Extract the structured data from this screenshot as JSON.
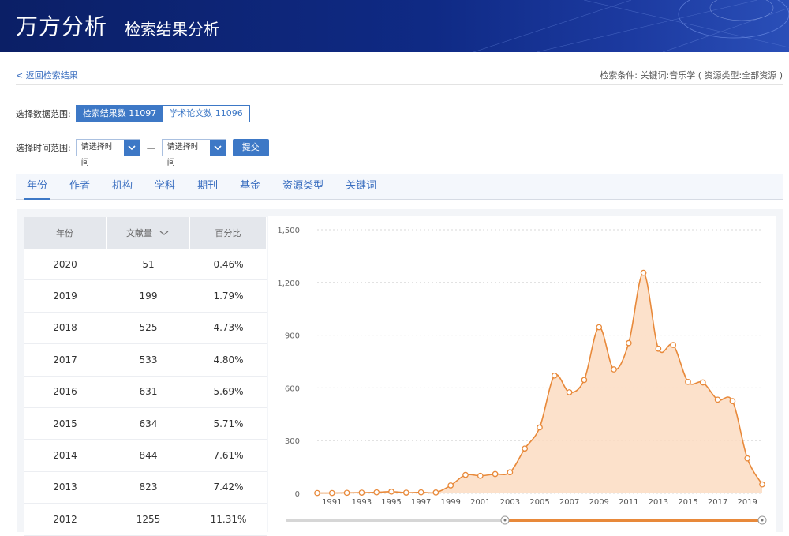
{
  "header": {
    "brand": "万方分析",
    "subtitle": "检索结果分析"
  },
  "topbar": {
    "back": "< 返回检索结果",
    "conditions": "检索条件:  关键词:音乐学  ( 资源类型:全部资源 )"
  },
  "data_range": {
    "label": "选择数据范围:",
    "options": [
      {
        "label": "检索结果数 11097",
        "active": true
      },
      {
        "label": "学术论文数 11096",
        "active": false
      }
    ]
  },
  "time_range": {
    "label": "选择时间范围:",
    "from_placeholder": "请选择时间",
    "to_placeholder": "请选择时间",
    "dash": "—",
    "submit": "提交"
  },
  "tabs": [
    "年份",
    "作者",
    "机构",
    "学科",
    "期刊",
    "基金",
    "资源类型",
    "关键词"
  ],
  "table": {
    "headers": [
      "年份",
      "文献量",
      "百分比"
    ],
    "rows": [
      [
        "2020",
        "51",
        "0.46%"
      ],
      [
        "2019",
        "199",
        "1.79%"
      ],
      [
        "2018",
        "525",
        "4.73%"
      ],
      [
        "2017",
        "533",
        "4.80%"
      ],
      [
        "2016",
        "631",
        "5.69%"
      ],
      [
        "2015",
        "634",
        "5.71%"
      ],
      [
        "2014",
        "844",
        "7.61%"
      ],
      [
        "2013",
        "823",
        "7.42%"
      ],
      [
        "2012",
        "1255",
        "11.31%"
      ]
    ]
  },
  "chart_data": {
    "type": "area",
    "x": [
      1990,
      1991,
      1992,
      1993,
      1994,
      1995,
      1996,
      1997,
      1998,
      1999,
      2000,
      2001,
      2002,
      2003,
      2004,
      2005,
      2006,
      2007,
      2008,
      2009,
      2010,
      2011,
      2012,
      2013,
      2014,
      2015,
      2016,
      2017,
      2018,
      2019,
      2020
    ],
    "values": [
      2,
      2,
      3,
      4,
      6,
      10,
      4,
      6,
      5,
      45,
      105,
      100,
      110,
      120,
      255,
      375,
      670,
      575,
      645,
      945,
      705,
      855,
      1255,
      823,
      844,
      634,
      631,
      533,
      525,
      199,
      51
    ],
    "y_ticks": [
      "0",
      "300",
      "600",
      "900",
      "1,200",
      "1,500"
    ],
    "x_tick_labels": [
      "1991",
      "1993",
      "1995",
      "1997",
      "1999",
      "2001",
      "2003",
      "2005",
      "2007",
      "2009",
      "2011",
      "2013",
      "2015",
      "2017",
      "2019"
    ],
    "ylim": [
      0,
      1500
    ],
    "xlim": [
      1990,
      2020
    ],
    "grid": true,
    "colors": {
      "line": "#e8893a",
      "fill": "#fbdcc2",
      "slider": "#e8893a"
    }
  }
}
